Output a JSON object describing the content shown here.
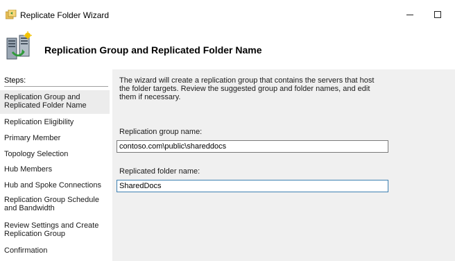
{
  "window": {
    "title": "Replicate Folder Wizard",
    "minimize_glyph": "—",
    "maximize_glyph": "☐"
  },
  "header": {
    "title": "Replication Group and Replicated Folder Name",
    "icon": "replication-server-icon"
  },
  "steps": {
    "heading": "Steps:",
    "items": [
      {
        "label": "Replication Group and Replicated Folder Name",
        "active": true
      },
      {
        "label": "Replication Eligibility",
        "active": false
      },
      {
        "label": "Primary Member",
        "active": false
      },
      {
        "label": "Topology Selection",
        "active": false
      },
      {
        "label": "Hub Members",
        "active": false
      },
      {
        "label": "Hub and Spoke Connections",
        "active": false
      },
      {
        "label": "Replication Group Schedule and Bandwidth",
        "active": false
      },
      {
        "label": "Review Settings and Create Replication Group",
        "active": false
      },
      {
        "label": "Confirmation",
        "active": false
      }
    ]
  },
  "content": {
    "intro": "The wizard will create a replication group that contains the servers that host the folder targets. Review the suggested group and folder names, and edit them if necessary.",
    "group_name_label": "Replication group name:",
    "group_name_value": "contoso.com\\public\\shareddocs",
    "folder_name_label": "Replicated folder name:",
    "folder_name_value": "SharedDocs"
  },
  "colors": {
    "content_bg": "#f0f0f0",
    "active_step_bg": "#ececec",
    "focus_border": "#3c7fb1"
  }
}
